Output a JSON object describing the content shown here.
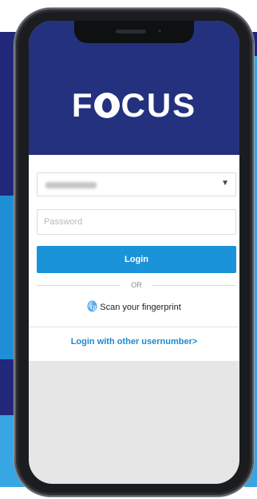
{
  "app": {
    "logo_text": "FOCUS",
    "brand_color": "#24317f",
    "accent_color": "#1a93d8"
  },
  "login_form": {
    "user_select": {
      "selected_value": "",
      "icon": "chevron-down-icon"
    },
    "password": {
      "placeholder": "Password",
      "value": ""
    },
    "login_button_label": "Login",
    "divider_label": "OR",
    "fingerprint": {
      "icon": "fingerprint-icon",
      "label": "Scan your fingerprint"
    },
    "other_user_link": "Login with other usernumber>"
  }
}
